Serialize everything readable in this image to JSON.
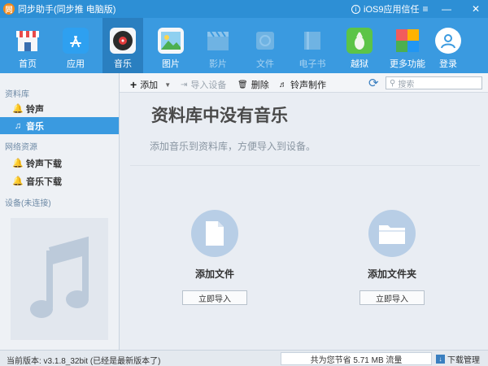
{
  "window": {
    "title": "同步助手(同步推 电脑版)",
    "ios_trust": "iOS9应用信任",
    "logo_char": "同"
  },
  "toolbar": {
    "items": [
      {
        "label": "首页",
        "icon": "store-icon"
      },
      {
        "label": "应用",
        "icon": "app-store-icon"
      },
      {
        "label": "音乐",
        "icon": "music-disc-icon"
      },
      {
        "label": "图片",
        "icon": "picture-icon"
      },
      {
        "label": "影片",
        "icon": "film-icon"
      },
      {
        "label": "文件",
        "icon": "file-icon"
      },
      {
        "label": "电子书",
        "icon": "book-icon"
      },
      {
        "label": "越狱",
        "icon": "pineapple-icon"
      },
      {
        "label": "更多功能",
        "icon": "more-grid-icon"
      },
      {
        "label": "登录",
        "icon": "user-icon"
      }
    ]
  },
  "sidebar": {
    "library_header": "资料库",
    "ringtone": "铃声",
    "music": "音乐",
    "online_header": "网络资源",
    "ringtone_download": "铃声下载",
    "music_download": "音乐下载",
    "device_header": "设备(未连接)"
  },
  "actions": {
    "add": "添加",
    "import_device": "导入设备",
    "delete": "删除",
    "ringtone_make": "铃声制作",
    "search_placeholder": "搜索"
  },
  "main": {
    "title": "资料库中没有音乐",
    "subtitle": "添加音乐到资料库，方便导入到设备。",
    "add_file": "添加文件",
    "add_folder": "添加文件夹",
    "import_now": "立即导入"
  },
  "status": {
    "version": "当前版本: v3.1.8_32bit    (已经是最新版本了)",
    "traffic": "共为您节省  5.71 MB 流量",
    "download_manager": "下载管理"
  },
  "colors": {
    "titlebar": "#2d8fd5",
    "toolbar": "#3a9ae0",
    "active_tab": "#2a7fc0",
    "accent": "#3a9ae0"
  }
}
